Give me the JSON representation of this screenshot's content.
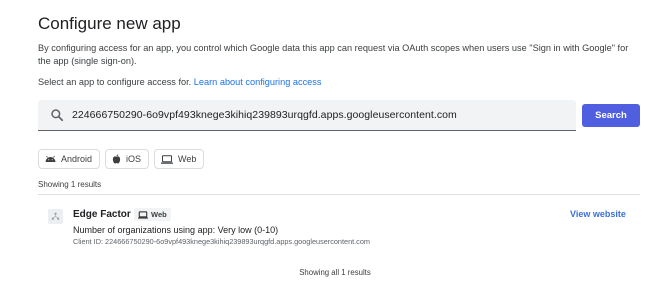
{
  "page": {
    "title": "Configure new app",
    "description": "By configuring access for an app, you control which Google data this app can request via OAuth scopes when users use \"Sign in with Google\" for the app (single sign-on).",
    "select_prefix": "Select an app to configure access for.",
    "learn_link": "Learn about configuring access"
  },
  "search": {
    "value": "224666750290-6o9vpf493knege3kihiq239893urqgfd.apps.googleusercontent.com",
    "button_label": "Search"
  },
  "filters": [
    {
      "label": "Android",
      "icon": "android-icon"
    },
    {
      "label": "iOS",
      "icon": "apple-icon"
    },
    {
      "label": "Web",
      "icon": "laptop-icon"
    }
  ],
  "results": {
    "count_label": "Showing 1 results",
    "items": [
      {
        "name": "Edge Factor",
        "platform": "Web",
        "orgs": "Number of organizations using app: Very low (0-10)",
        "client_id": "Client ID: 224666750290-6o9vpf493knege3kihiq239893urqgfd.apps.googleusercontent.com",
        "action": "View website"
      }
    ],
    "footer": "Showing all 1 results"
  },
  "colors": {
    "accent": "#4f5fe0",
    "link": "#1a73e8"
  }
}
